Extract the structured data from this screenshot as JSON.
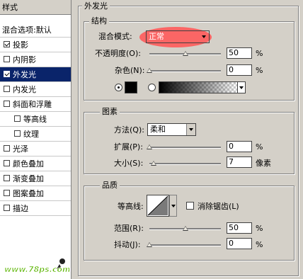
{
  "left_panel": {
    "header": "样式",
    "blend_options": "混合选项:默认",
    "items": [
      {
        "label": "投影",
        "checked": true
      },
      {
        "label": "内阴影",
        "checked": false
      },
      {
        "label": "外发光",
        "checked": true,
        "selected": true
      },
      {
        "label": "内发光",
        "checked": false
      },
      {
        "label": "斜面和浮雕",
        "checked": false
      },
      {
        "label": "等高线",
        "checked": false
      },
      {
        "label": "纹理",
        "checked": false
      },
      {
        "label": "光泽",
        "checked": false
      },
      {
        "label": "颜色叠加",
        "checked": false
      },
      {
        "label": "渐变叠加",
        "checked": false
      },
      {
        "label": "图案叠加",
        "checked": false
      },
      {
        "label": "描边",
        "checked": false
      }
    ]
  },
  "outer_glow": {
    "title": "外发光",
    "structure": {
      "title": "结构",
      "blend_mode_label": "混合模式:",
      "blend_mode_value": "正常",
      "opacity_label": "不透明度(O):",
      "opacity_value": "50",
      "noise_label": "杂色(N):",
      "noise_value": "0",
      "unit_percent": "%",
      "color_swatch": "#000000"
    },
    "elements": {
      "title": "图素",
      "technique_label": "方法(Q):",
      "technique_value": "柔和",
      "spread_label": "扩展(P):",
      "spread_value": "0",
      "size_label": "大小(S):",
      "size_value": "7",
      "unit_percent": "%",
      "unit_pixels": "像素"
    },
    "quality": {
      "title": "品质",
      "contour_label": "等高线:",
      "antialias_label": "消除锯齿(L)",
      "range_label": "范围(R):",
      "range_value": "50",
      "jitter_label": "抖动(J):",
      "jitter_value": "0",
      "unit_percent": "%"
    }
  },
  "watermark": "www.78ps.com",
  "colors": {
    "selection": "#0a246a",
    "highlight": "#ff5a5a",
    "watermark": "#5ab400"
  }
}
